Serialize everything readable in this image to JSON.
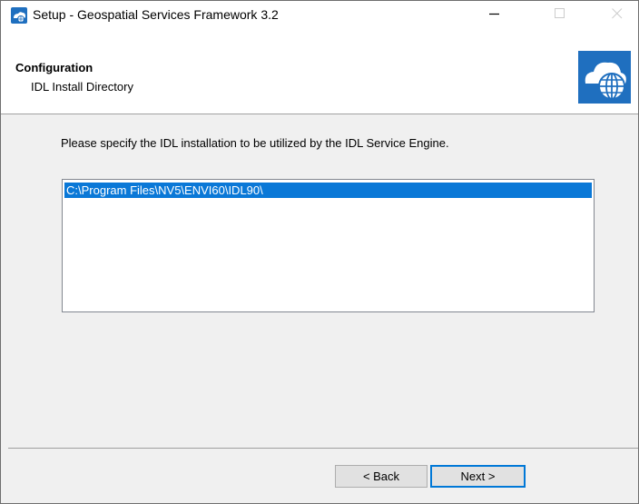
{
  "window": {
    "title": "Setup - Geospatial Services Framework 3.2",
    "controls": {
      "minimize": "minimize-icon",
      "maximize": "maximize-icon",
      "close": "close-icon"
    }
  },
  "header": {
    "title": "Configuration",
    "subtitle": "IDL Install Directory",
    "logo": "cloud-globe-icon"
  },
  "main": {
    "instruction": "Please specify the IDL installation to be utilized by the IDL Service Engine.",
    "list": {
      "items": [
        "C:\\Program Files\\NV5\\ENVI60\\IDL90\\"
      ],
      "selected_index": 0
    }
  },
  "footer": {
    "back_label": "< Back",
    "next_label": "Next >"
  },
  "colors": {
    "selection": "#0a78d7",
    "dialog_bg": "#f0f0f0",
    "default_button_border": "#0078d7",
    "logo_blue": "#1f6fbf"
  }
}
